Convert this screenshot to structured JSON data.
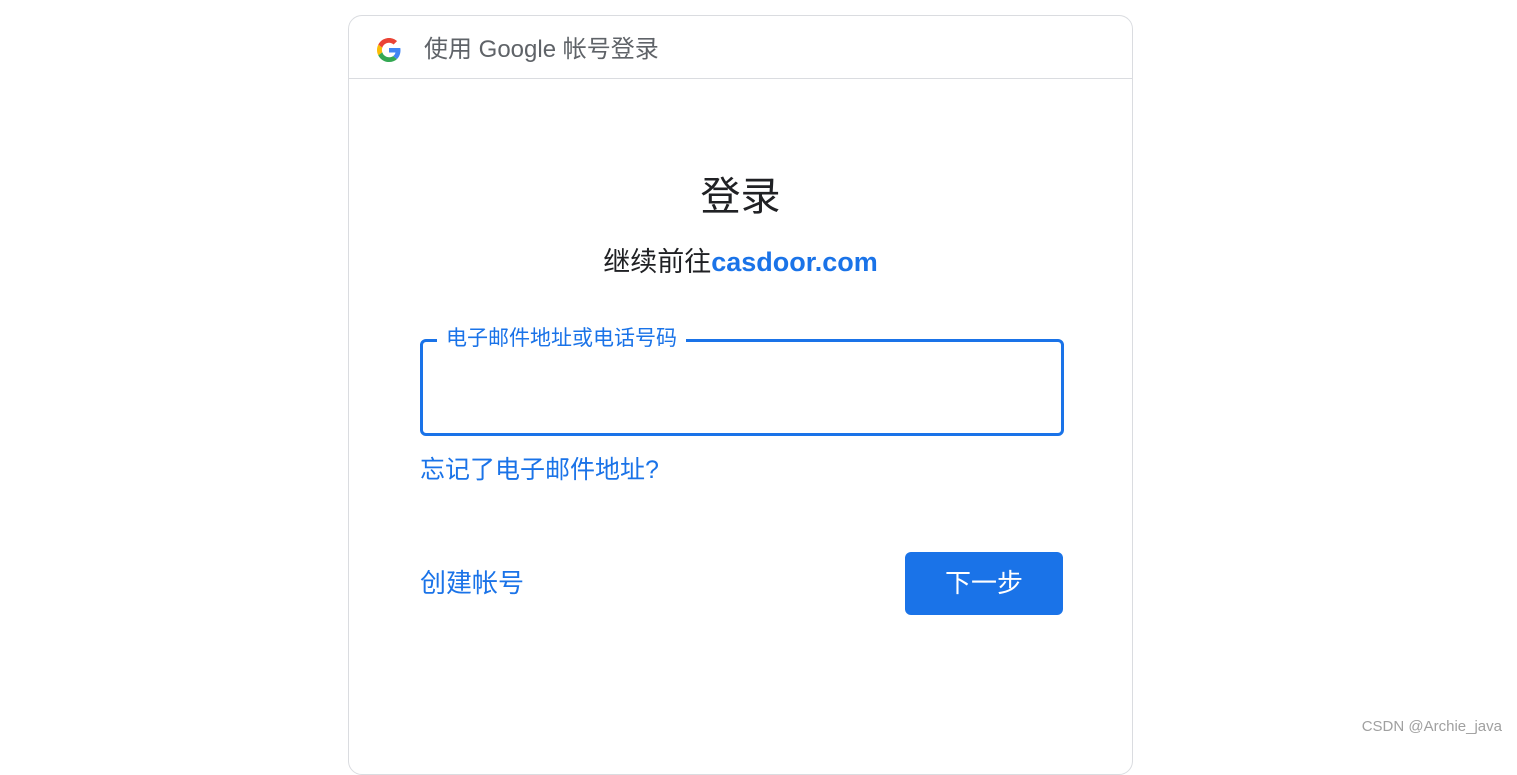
{
  "header": {
    "title": "使用 Google 帐号登录",
    "logo_icon": "google-g-icon"
  },
  "main": {
    "heading": "登录",
    "subheading_prefix": "继续前往",
    "subheading_link": "casdoor.com"
  },
  "email_field": {
    "label": "电子邮件地址或电话号码",
    "value": ""
  },
  "links": {
    "forgot_email": "忘记了电子邮件地址?",
    "create_account": "创建帐号"
  },
  "buttons": {
    "next": "下一步"
  },
  "watermark": "CSDN @Archie_java",
  "colors": {
    "accent": "#1a73e8",
    "text": "#202124",
    "muted": "#5f6368",
    "border": "#dadce0"
  }
}
